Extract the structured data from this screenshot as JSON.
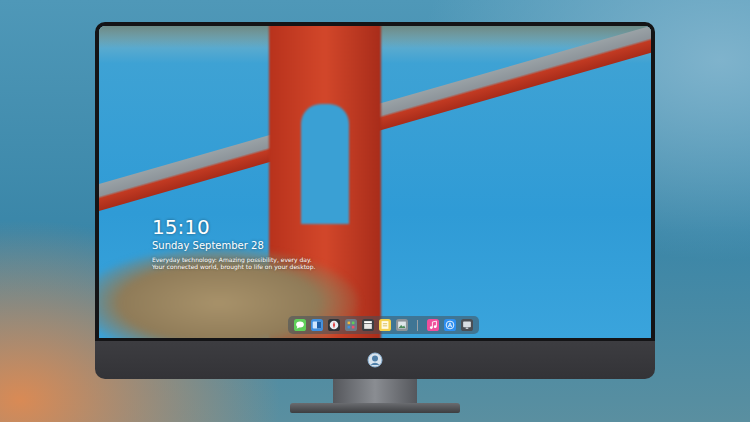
{
  "desktop": {
    "time": "15:10",
    "date": "Sunday September 28",
    "caption": [
      "Everyday technology: Amazing possibility, every day.",
      "Your connected world, brought to life on your desktop."
    ]
  },
  "dock": {
    "items": [
      {
        "kind": "chat",
        "color": "#5fcf5a"
      },
      {
        "kind": "folder",
        "color": "#3f8fe0"
      },
      {
        "kind": "compass",
        "color": "#2f3338"
      },
      {
        "kind": "grid",
        "color": "#6d7a86"
      },
      {
        "kind": "clapper",
        "color": "#3b3f44"
      },
      {
        "kind": "note",
        "color": "#f4d24e"
      },
      {
        "kind": "photo",
        "color": "#8b9399"
      },
      {
        "kind": "divider",
        "color": "#9aa0a6"
      },
      {
        "kind": "music",
        "color": "#f04f9c"
      },
      {
        "kind": "store",
        "color": "#2d8ff0"
      },
      {
        "kind": "screen",
        "color": "#4a4e54"
      }
    ]
  }
}
